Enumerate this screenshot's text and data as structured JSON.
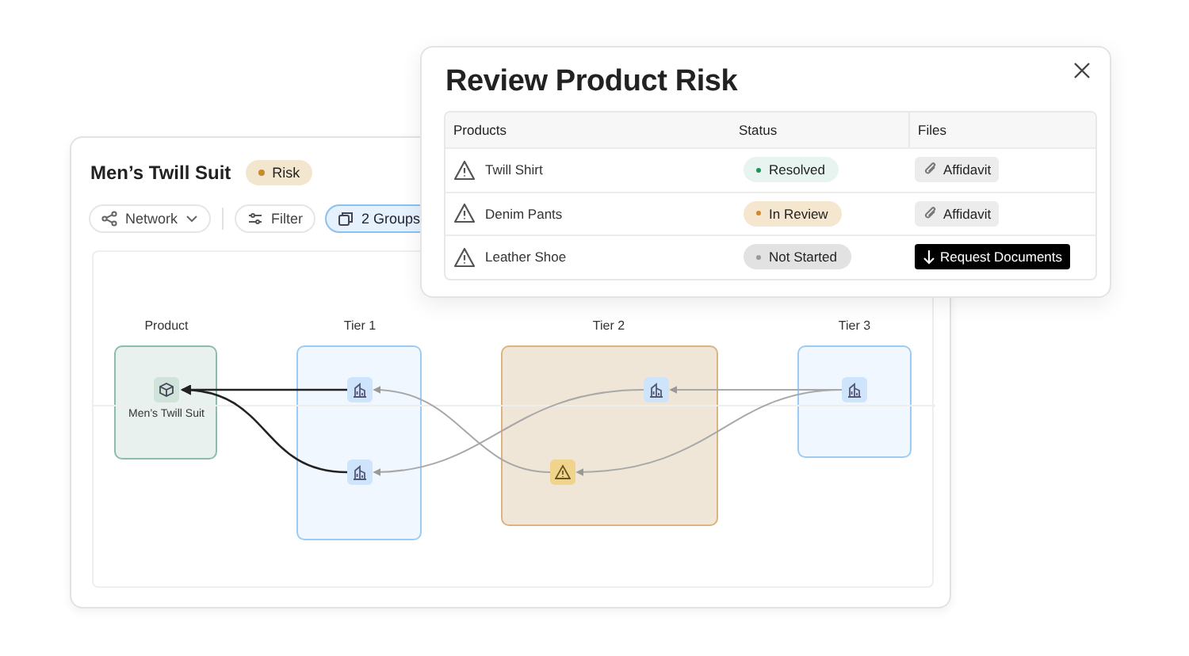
{
  "card": {
    "title": "Men’s Twill Suit",
    "badge": {
      "label": "Risk",
      "kind": "risk"
    },
    "toolbar": [
      {
        "label": "Network",
        "kind": "dropdown",
        "selected": false
      },
      {
        "label": "Filter",
        "kind": "filter",
        "selected": false
      },
      {
        "label": "2 Groups",
        "kind": "groups",
        "selected": true
      }
    ],
    "diagram": {
      "columns": [
        {
          "title": "Product",
          "kind": "product",
          "nodes": [
            {
              "kind": "product",
              "label": "Men’s Twill Suit"
            }
          ]
        },
        {
          "title": "Tier 1",
          "kind": "clear",
          "nodes": [
            {
              "kind": "supplier"
            },
            {
              "kind": "supplier"
            }
          ]
        },
        {
          "title": "Tier 2",
          "kind": "risk",
          "nodes": [
            {
              "kind": "supplier"
            },
            {
              "kind": "warning"
            }
          ]
        },
        {
          "title": "Tier 3",
          "kind": "clear",
          "nodes": [
            {
              "kind": "supplier"
            }
          ]
        }
      ]
    }
  },
  "modal": {
    "title": "Review Product Risk",
    "columns": [
      "Products",
      "Status",
      "Files"
    ],
    "rows": [
      {
        "product": "Twill Shirt",
        "status": {
          "label": "Resolved",
          "kind": "resolved"
        },
        "file": {
          "label": "Affidavit",
          "kind": "attachment"
        }
      },
      {
        "product": "Denim Pants",
        "status": {
          "label": "In Review",
          "kind": "review"
        },
        "file": {
          "label": "Affidavit",
          "kind": "attachment"
        }
      },
      {
        "product": "Leather Shoe",
        "status": {
          "label": "Not Started",
          "kind": "not_started"
        },
        "file": {
          "label": "Request Documents",
          "kind": "request"
        }
      }
    ]
  }
}
